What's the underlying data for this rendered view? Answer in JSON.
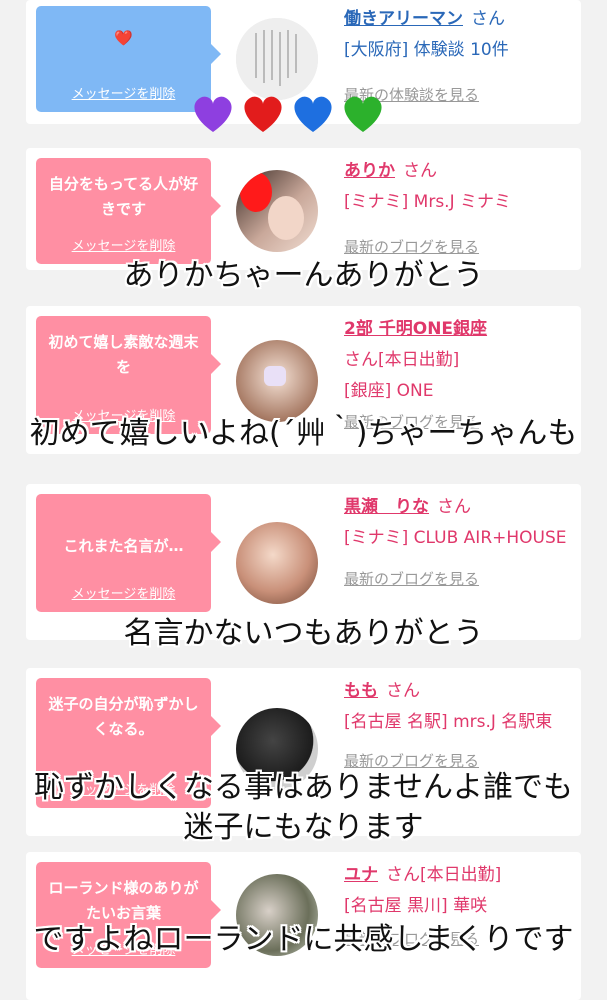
{
  "cards": [
    {
      "bubble": "❤️",
      "delete": "メッセージを削除",
      "name": "働きアリーマン",
      "san": "さん",
      "meta": "[大阪府] 体験談 10件",
      "blog": "最新の体験談を見る"
    },
    {
      "bubble": "自分をもってる人が好きです",
      "delete": "メッセージを削除",
      "name": "ありか",
      "san": "さん",
      "meta": "[ミナミ] Mrs.J ミナミ",
      "blog": "最新のブログを見る"
    },
    {
      "bubble": "初めて嬉し素敵な週末を",
      "delete": "メッセージを削除",
      "name": "2部 千明ONE銀座",
      "san": "さん[本日出勤]",
      "meta": "[銀座] ONE",
      "blog": "最新のブログを見る"
    },
    {
      "bubble": "これまた名言が…",
      "delete": "メッセージを削除",
      "name": "黒瀬　りな",
      "san": "さん",
      "meta": "[ミナミ] CLUB AIR+HOUSE",
      "blog": "最新のブログを見る"
    },
    {
      "bubble": "迷子の自分が恥ずかしくなる。",
      "delete": "メッセージを削除",
      "name": "もも",
      "san": "さん",
      "meta": "[名古屋 名駅] mrs.J 名駅東",
      "blog": "最新のブログを見る"
    },
    {
      "bubble": "ローランド様のありがたいお言葉",
      "delete": "メッセージを削除",
      "name": "ユナ",
      "san": "さん[本日出勤]",
      "meta": "[名古屋 黒川] 華咲",
      "blog": "最新のブログを見る"
    }
  ],
  "captions": [
    "ありかちゃーんありがとう",
    "初めて嬉しいよね(´艸｀)ちゃーちゃんも",
    "名言かないつもありがとう",
    "恥ずかしくなる事はありませんよ誰でも迷子にもなります",
    "ですよねローランドに共感しまくりです"
  ],
  "colors": {
    "pink": "#ff8fa3",
    "blue_bubble": "#7fb8f5",
    "name_pink": "#e0386b",
    "name_blue": "#2a68b8"
  }
}
